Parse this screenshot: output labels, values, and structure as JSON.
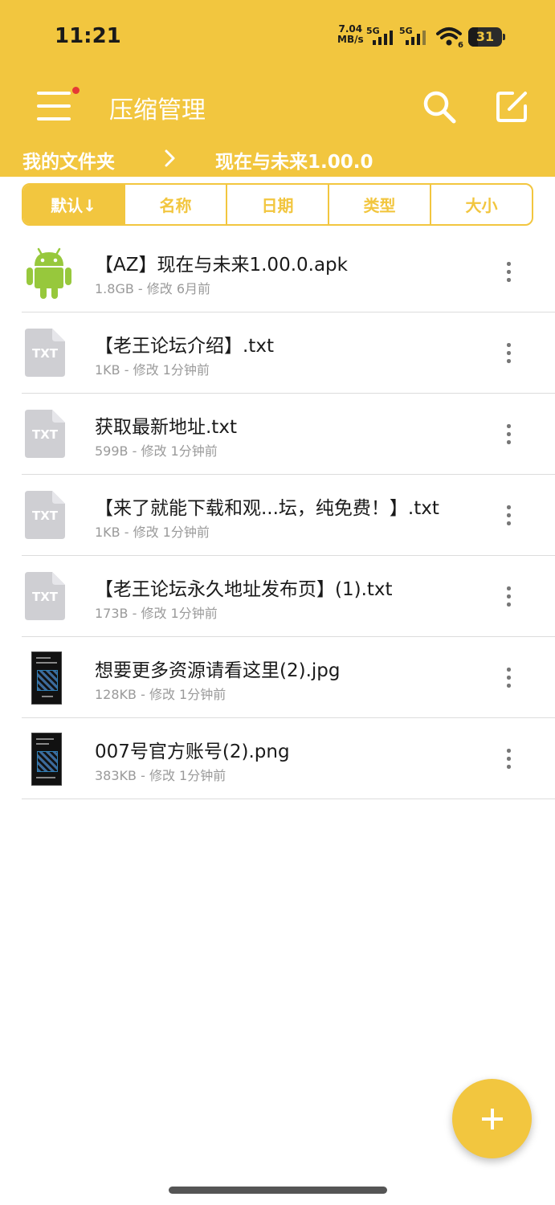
{
  "status_bar": {
    "time": "11:21",
    "net_speed_value": "7.04",
    "net_speed_unit": "MB/s",
    "sim1_label": "5G",
    "sim2_label": "5G",
    "wifi_badge": "6",
    "battery_level": "31"
  },
  "toolbar": {
    "title": "压缩管理",
    "menu_icon": "hamburger-menu-icon",
    "search_icon": "search-icon",
    "edit_icon": "edit-icon",
    "notification_dot_color": "#e53935"
  },
  "breadcrumb": {
    "root": "我的文件夹",
    "separator_icon": "chevron-right-icon",
    "current": "现在与未来1.00.0"
  },
  "sort_tabs": [
    {
      "label": "默认↓",
      "active": true
    },
    {
      "label": "名称",
      "active": false
    },
    {
      "label": "日期",
      "active": false
    },
    {
      "label": "类型",
      "active": false
    },
    {
      "label": "大小",
      "active": false
    }
  ],
  "files": [
    {
      "name": "【AZ】现在与未来1.00.0.apk",
      "meta": "1.8GB - 修改 6月前",
      "icon": "android-icon"
    },
    {
      "name": "【老王论坛介绍】.txt",
      "meta": "1KB - 修改 1分钟前",
      "icon": "txt-file-icon",
      "icon_text": "TXT"
    },
    {
      "name": "获取最新地址.txt",
      "meta": "599B - 修改 1分钟前",
      "icon": "txt-file-icon",
      "icon_text": "TXT"
    },
    {
      "name": "【来了就能下载和观...坛，纯免费！】.txt",
      "meta": "1KB - 修改 1分钟前",
      "icon": "txt-file-icon",
      "icon_text": "TXT"
    },
    {
      "name": "【老王论坛永久地址发布页】(1).txt",
      "meta": "173B - 修改 1分钟前",
      "icon": "txt-file-icon",
      "icon_text": "TXT"
    },
    {
      "name": "想要更多资源请看这里(2).jpg",
      "meta": "128KB - 修改 1分钟前",
      "icon": "image-thumbnail"
    },
    {
      "name": "007号官方账号(2).png",
      "meta": "383KB - 修改 1分钟前",
      "icon": "image-thumbnail"
    }
  ],
  "fab": {
    "icon": "plus-icon"
  },
  "colors": {
    "accent": "#f2c63f",
    "android_green": "#97c83c",
    "txt_icon_gray": "#cfcfd3"
  }
}
